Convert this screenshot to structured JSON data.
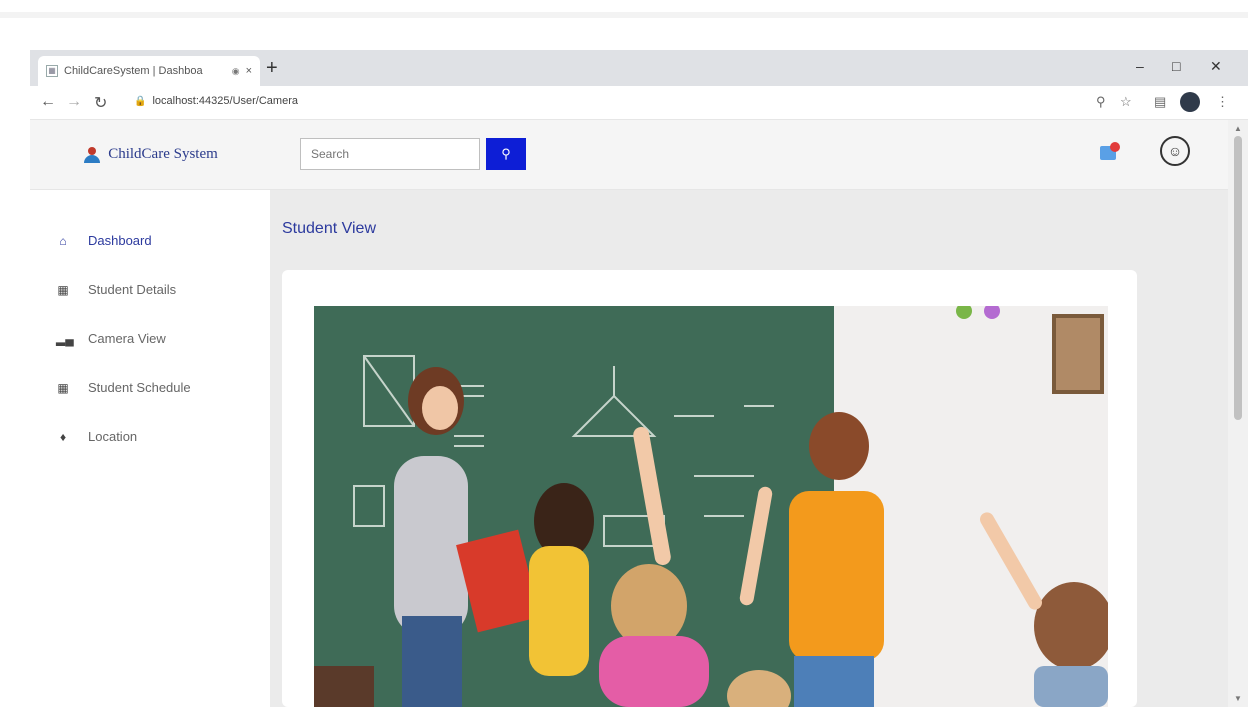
{
  "browser": {
    "tab_title": "ChildCareSystem | Dashboa",
    "tab_close": "×",
    "new_tab": "+",
    "url": "localhost:44325/User/Camera",
    "window_controls": [
      "–",
      "□",
      "✕"
    ]
  },
  "app": {
    "brand": "ChildCare System",
    "search": {
      "placeholder": "Search"
    },
    "menu": [
      {
        "label": "Dashboard",
        "icon": "home-icon",
        "active": true
      },
      {
        "label": "Student Details",
        "icon": "table-icon",
        "active": false
      },
      {
        "label": "Camera View",
        "icon": "chart-icon",
        "active": false
      },
      {
        "label": "Student Schedule",
        "icon": "table-icon",
        "active": false
      },
      {
        "label": "Location",
        "icon": "map-marker-icon",
        "active": false
      }
    ],
    "page_title": "Student View",
    "accent_color": "#0d1ed6",
    "title_color": "#2c3a9e"
  }
}
